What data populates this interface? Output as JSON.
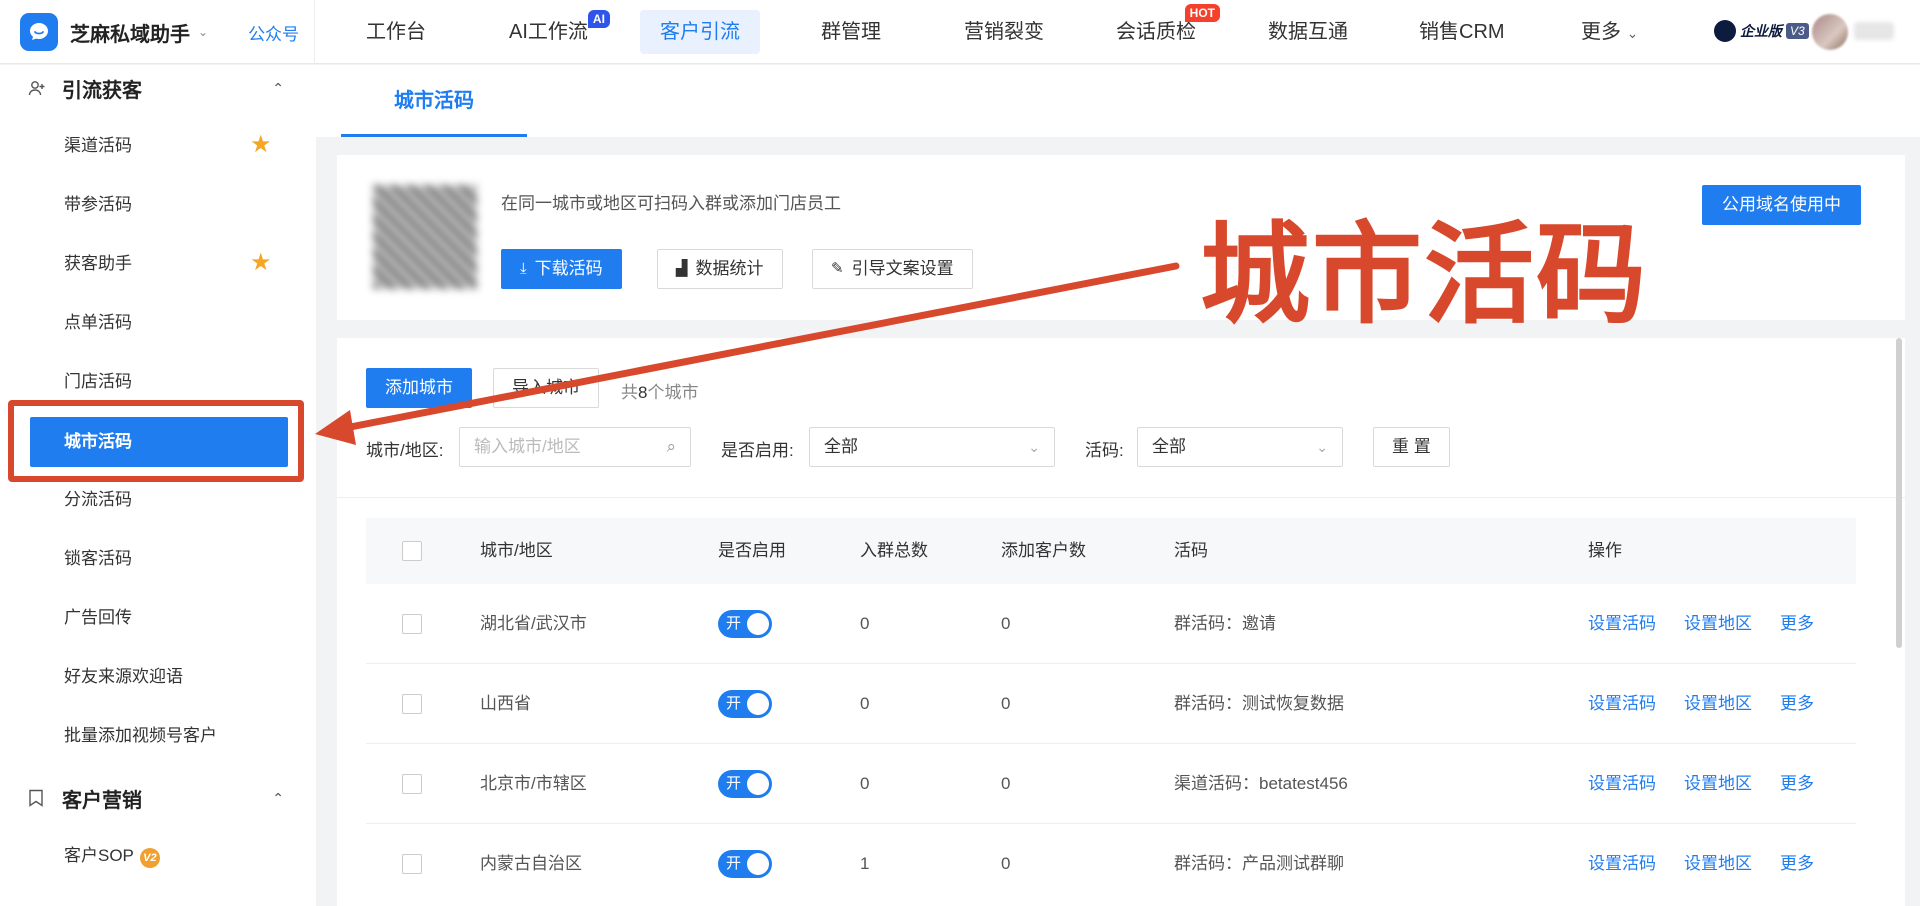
{
  "app": {
    "name": "芝麻私域助手",
    "gzh": "公众号"
  },
  "nav": {
    "items": [
      "工作台",
      "AI工作流",
      "客户引流",
      "群管理",
      "营销裂变",
      "会话质检",
      "数据互通",
      "销售CRM",
      "更多"
    ],
    "ai_badge": "AI",
    "hot_badge": "HOT",
    "more_caret": "⌄",
    "enterprise": "企业版",
    "version": "V3"
  },
  "sidebar": {
    "group1": "引流获客",
    "items": [
      "渠道活码",
      "带参活码",
      "获客助手",
      "点单活码",
      "门店活码",
      "城市活码",
      "分流活码",
      "锁客活码",
      "广告回传",
      "好友来源欢迎语",
      "批量添加视频号客户"
    ],
    "group2": "客户营销",
    "item_sop": "客户SOP",
    "sop_badge": "V2"
  },
  "tabs": {
    "active": "城市活码"
  },
  "info": {
    "desc": "在同一城市或地区可扫码入群或添加门店员工",
    "download_btn": "下载活码",
    "stats_btn": "数据统计",
    "guide_btn": "引导文案设置",
    "domain_btn": "公用域名使用中"
  },
  "annotation": "城市活码",
  "filter": {
    "add_city": "添加城市",
    "import_city": "导入城市",
    "count_prefix": "共",
    "count": "8",
    "count_suffix": "个城市",
    "city_label": "城市/地区:",
    "city_placeholder": "输入城市/地区",
    "enabled_label": "是否启用:",
    "enabled_value": "全部",
    "code_label": "活码:",
    "code_value": "全部",
    "reset": "重 置"
  },
  "table": {
    "columns": [
      "城市/地区",
      "是否启用",
      "入群总数",
      "添加客户数",
      "活码",
      "操作"
    ],
    "toggle_label": "开",
    "actions": [
      "设置活码",
      "设置地区",
      "更多"
    ],
    "rows": [
      {
        "city": "湖北省/武汉市",
        "join": "0",
        "add": "0",
        "code": "群活码：邀请"
      },
      {
        "city": "山西省",
        "join": "0",
        "add": "0",
        "code": "群活码：测试恢复数据"
      },
      {
        "city": "北京市/市辖区",
        "join": "0",
        "add": "0",
        "code": "渠道活码：betatest456"
      },
      {
        "city": "内蒙古自治区",
        "join": "1",
        "add": "0",
        "code": "群活码：产品测试群聊"
      }
    ]
  },
  "colors": {
    "primary": "#1f7df0",
    "annotation": "#d8482c",
    "star": "#f5a623"
  }
}
